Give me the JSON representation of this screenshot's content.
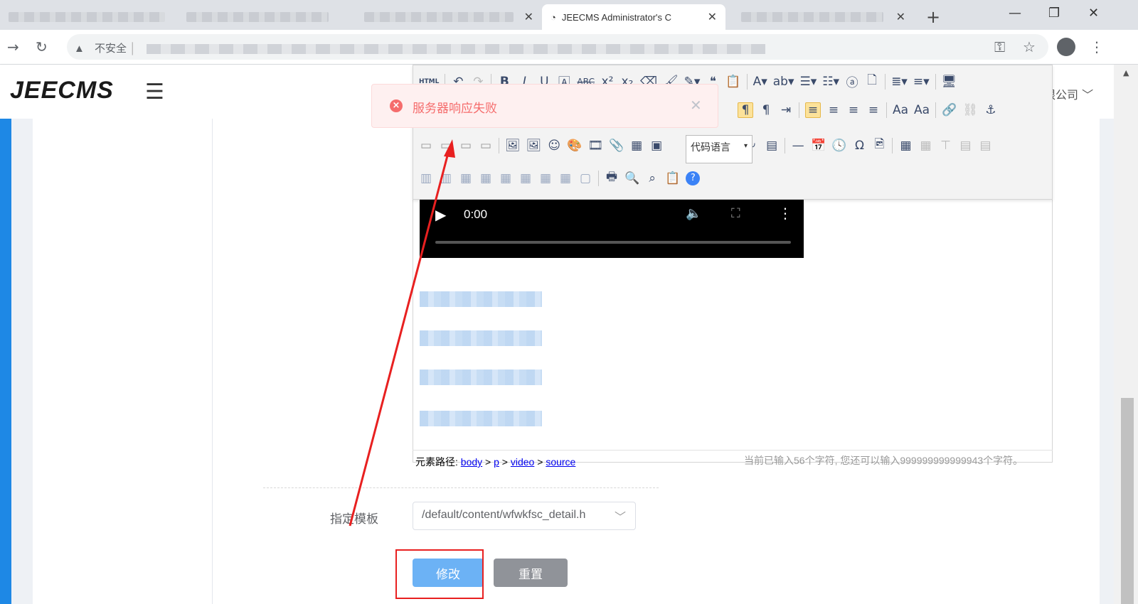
{
  "browser": {
    "active_tab_title": "JEECMS Administrator's C",
    "tab_close_glyph": "✕",
    "new_tab_glyph": "+",
    "security_label": "不安全",
    "window_controls": [
      "—",
      "❐",
      "✕"
    ]
  },
  "header": {
    "logo": "JEECMS",
    "company_partial": "限公司"
  },
  "editor": {
    "code_language": "代码语言",
    "video": {
      "time": "0:00"
    },
    "element_path_label": "元素路径:",
    "element_path": [
      "body",
      "p",
      "video",
      "source"
    ],
    "char_count": "当前已输入56个字符, 您还可以输入999999999999943个字符。"
  },
  "form": {
    "template_label": "指定模板",
    "template_value": "/default/content/wfwkfsc_detail.h",
    "submit_label": "修改",
    "reset_label": "重置"
  },
  "toast": {
    "message": "服务器响应失败"
  },
  "colors": {
    "accent": "#1e88e5",
    "error": "#f56c6c",
    "submit": "#6cb2f5",
    "annotation": "#e82020"
  }
}
